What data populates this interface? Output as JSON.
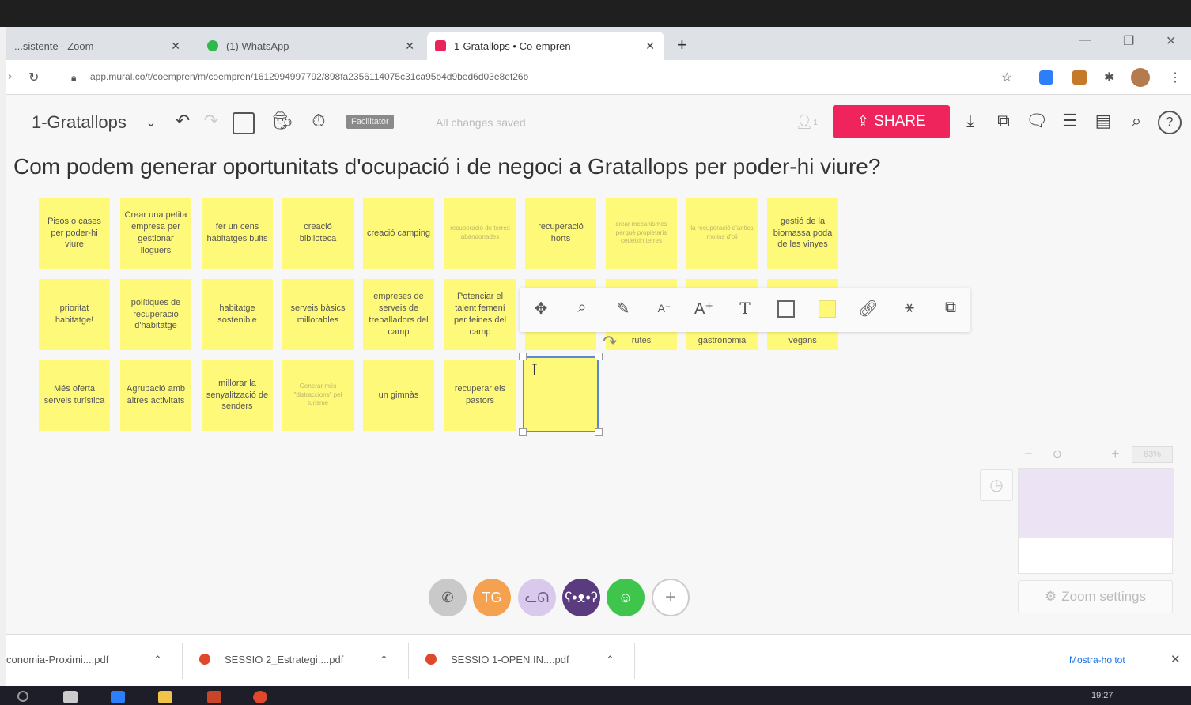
{
  "browser": {
    "tabs": [
      {
        "label": "...sistente - Zoom",
        "active": false
      },
      {
        "label": "(1) WhatsApp",
        "active": false
      },
      {
        "label": "1-Gratallops • Co-empren",
        "active": true
      }
    ],
    "url": "app.mural.co/t/coempren/m/coempren/1612994997792/898fa2356114075c31ca95b4d9bed6d03e8ef26b"
  },
  "toolbar": {
    "board_name": "1-Gratallops",
    "facilitator_label": "Facilitator",
    "save_status": "All changes saved",
    "share_label": "SHARE",
    "user_count": "1"
  },
  "canvas": {
    "title": "Com podem generar oportunitats d'ocupació i de negoci a Gratallops per poder-hi viure?",
    "rows": [
      [
        {
          "text": "Pisos o cases per poder-hi viure",
          "faint": false
        },
        {
          "text": "Crear una petita empresa per gestionar lloguers",
          "faint": false
        },
        {
          "text": "fer un cens habitatges buits",
          "faint": false
        },
        {
          "text": "creació biblioteca",
          "faint": false
        },
        {
          "text": "creació camping",
          "faint": false
        },
        {
          "text": "recuperació de terres abandonades",
          "faint": true
        },
        {
          "text": "recuperació horts",
          "faint": false
        },
        {
          "text": "crear mecanismes perquè propietaris cedeixin terres",
          "faint": true
        },
        {
          "text": "la recuperació d'antics molins d'oli",
          "faint": true
        },
        {
          "text": "gestió de la biomassa poda de les vinyes",
          "faint": false
        }
      ],
      [
        {
          "text": "prioritat habitatge!",
          "faint": false
        },
        {
          "text": "polítiques de recuperació d'habitatge",
          "faint": false
        },
        {
          "text": "habitatge sostenible",
          "faint": false
        },
        {
          "text": "serveis bàsics millorables",
          "faint": false
        },
        {
          "text": "empreses de serveis de treballadors del camp",
          "faint": false
        },
        {
          "text": "Potenciar el talent femení per feines del camp",
          "faint": false
        }
      ],
      [
        {
          "text": "Més oferta serveis turística",
          "faint": false
        },
        {
          "text": "Agrupació amb altres activitats",
          "faint": false
        },
        {
          "text": "millorar la senyalització de senders",
          "faint": false
        },
        {
          "text": "Generar més \"distraccions\" pel turisme",
          "faint": true
        },
        {
          "text": "un gimnàs",
          "faint": false
        },
        {
          "text": "recuperar els pastors",
          "faint": false
        }
      ]
    ],
    "hidden_row2_partial": [
      "rutes",
      "gastronomia",
      "vegans"
    ]
  },
  "minimap": {
    "zoom_pct": "63%",
    "zoom_settings_label": "Zoom settings"
  },
  "participants": [
    {
      "initials": "",
      "color": "#c9c9c9",
      "icon": "phone-icon"
    },
    {
      "initials": "TG",
      "color": "#f4a150",
      "icon": ""
    },
    {
      "initials": "",
      "color": "#d9c9ec",
      "icon": "cat-icon"
    },
    {
      "initials": "",
      "color": "#5b3b80",
      "icon": "bear-icon"
    },
    {
      "initials": "",
      "color": "#3fc44c",
      "icon": "frog-icon"
    }
  ],
  "downloads": [
    {
      "name": "conomia-Proximi....pdf"
    },
    {
      "name": "SESSIO 2_Estrategi....pdf"
    },
    {
      "name": "SESSIO 1-OPEN IN....pdf"
    }
  ],
  "downloads_show_all": "Mostra-ho tot",
  "clock": "19:27",
  "colors": {
    "share": "#f0245d",
    "sticky": "#fff97a",
    "selection": "#5a8ad6"
  }
}
